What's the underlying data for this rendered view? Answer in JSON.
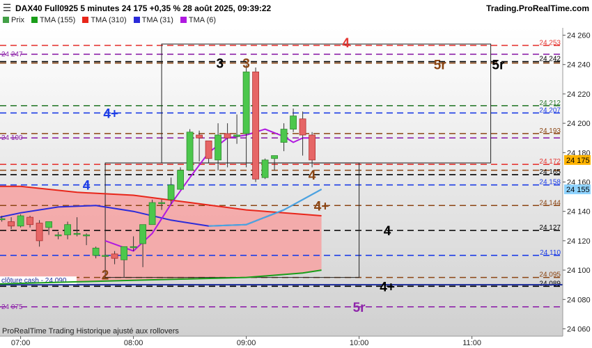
{
  "header": {
    "title": "DAX40 Full0925 5 minutes 24 175 +0,35 % 28 août 2025, 09:39:22",
    "brand": "Trading.ProRealTime.com",
    "menu_icon": "hamburger-menu-icon"
  },
  "legend": [
    {
      "label": "Prix",
      "color": "#43a047"
    },
    {
      "label": "TMA (155)",
      "color": "#1a9e1a"
    },
    {
      "label": "TMA (310)",
      "color": "#e8261a"
    },
    {
      "label": "TMA (31)",
      "color": "#2b2bd9"
    },
    {
      "label": "TMA (6)",
      "color": "#b019e0"
    }
  ],
  "footer": {
    "note": "ProRealTime Trading  Historique ajusté aux rollovers",
    "close_label": "clôture cash -  24 090"
  },
  "chart_data": {
    "type": "candlestick",
    "timeframe": "5 minutes",
    "ylim": [
      24055,
      24265
    ],
    "y_ticks": [
      "24 260",
      "24 240",
      "24 220",
      "24 200",
      "24 180",
      "24 160",
      "24 140",
      "24 120",
      "24 100",
      "24 080",
      "24 060"
    ],
    "x_ticks": [
      "07:00",
      "08:00",
      "09:00",
      "10:00",
      "11:00"
    ],
    "last_price_label": "24 175",
    "last_price": 24175,
    "tma6_label": "24 155",
    "tma6_value": 24155,
    "levels": [
      {
        "value": 24253,
        "label": "24 253",
        "color": "#e53935",
        "left_label": ""
      },
      {
        "value": 24247,
        "label": "",
        "color": "#8e24aa",
        "left_label": "24 247"
      },
      {
        "value": 24242,
        "label": "24 242",
        "color": "#000000",
        "left_label": ""
      },
      {
        "value": 24241,
        "label": "",
        "color": "#8b4513",
        "left_label": ""
      },
      {
        "value": 24212,
        "label": "24 212",
        "color": "#2e7d32",
        "left_label": ""
      },
      {
        "value": 24207,
        "label": "24 207",
        "color": "#1e3ee6",
        "left_label": ""
      },
      {
        "value": 24193,
        "label": "24 193",
        "color": "#8b4513",
        "left_label": ""
      },
      {
        "value": 24190,
        "label": "",
        "color": "#8e24aa",
        "left_label": "24 190"
      },
      {
        "value": 24172,
        "label": "24 172",
        "color": "#e53935",
        "left_label": ""
      },
      {
        "value": 24168,
        "label": "",
        "color": "#8b4513",
        "left_label": ""
      },
      {
        "value": 24165,
        "label": "24 165",
        "color": "#000000",
        "left_label": ""
      },
      {
        "value": 24158,
        "label": "24 158",
        "color": "#1e3ee6",
        "left_label": ""
      },
      {
        "value": 24144,
        "label": "24 144",
        "color": "#8b4513",
        "left_label": ""
      },
      {
        "value": 24127,
        "label": "24 127",
        "color": "#000000",
        "left_label": ""
      },
      {
        "value": 24110,
        "label": "24 110",
        "color": "#1e3ee6",
        "left_label": ""
      },
      {
        "value": 24095,
        "label": "24 095",
        "color": "#8b4513",
        "left_label": ""
      },
      {
        "value": 24089,
        "label": "24 089",
        "color": "#000000",
        "left_label": ""
      },
      {
        "value": 24075,
        "label": "",
        "color": "#8e24aa",
        "left_label": "24 075"
      }
    ],
    "close_line": 24090,
    "annotations": [
      {
        "text": "4",
        "t": "09:53",
        "y": 24255,
        "color": "#e53935"
      },
      {
        "text": "3",
        "t": "08:46",
        "y": 24241,
        "color": "#000000"
      },
      {
        "text": "3",
        "t": "09:00",
        "y": 24241,
        "color": "#8b4513"
      },
      {
        "text": "5r",
        "t": "10:43",
        "y": 24240,
        "color": "#8b4513"
      },
      {
        "text": "5r",
        "t": "11:14",
        "y": 24240,
        "color": "#000000"
      },
      {
        "text": "4+",
        "t": "07:48",
        "y": 24207,
        "color": "#1e3ee6"
      },
      {
        "text": "4",
        "t": "09:35",
        "y": 24165,
        "color": "#8b4513"
      },
      {
        "text": "4",
        "t": "07:35",
        "y": 24158,
        "color": "#1e3ee6"
      },
      {
        "text": "4+",
        "t": "09:40",
        "y": 24144,
        "color": "#8b4513"
      },
      {
        "text": "4",
        "t": "10:15",
        "y": 24127,
        "color": "#000000"
      },
      {
        "text": "2",
        "t": "07:45",
        "y": 24097,
        "color": "#8b4513"
      },
      {
        "text": "4+",
        "t": "10:15",
        "y": 24089,
        "color": "#000000"
      },
      {
        "text": "5r",
        "t": "10:00",
        "y": 24075,
        "color": "#8e24aa"
      }
    ],
    "boxes": [
      {
        "t1": "08:15",
        "t2": "11:10",
        "y1": 24173,
        "y2": 24254
      },
      {
        "t1": "07:45",
        "t2": "10:00",
        "y1": 24095,
        "y2": 24173
      }
    ],
    "candles": [
      {
        "t": "06:50",
        "o": 24135,
        "h": 24137,
        "l": 24133,
        "c": 24135
      },
      {
        "t": "06:55",
        "o": 24133,
        "h": 24136,
        "l": 24128,
        "c": 24130
      },
      {
        "t": "07:00",
        "o": 24130,
        "h": 24138,
        "l": 24129,
        "c": 24137
      },
      {
        "t": "07:05",
        "o": 24136,
        "h": 24137,
        "l": 24129,
        "c": 24131
      },
      {
        "t": "07:10",
        "o": 24132,
        "h": 24134,
        "l": 24116,
        "c": 24120
      },
      {
        "t": "07:15",
        "o": 24129,
        "h": 24133,
        "l": 24124,
        "c": 24133
      },
      {
        "t": "07:20",
        "o": 24124,
        "h": 24126,
        "l": 24121,
        "c": 24124
      },
      {
        "t": "07:25",
        "o": 24124,
        "h": 24133,
        "l": 24121,
        "c": 24131
      },
      {
        "t": "07:30",
        "o": 24125,
        "h": 24136,
        "l": 24123,
        "c": 24125
      },
      {
        "t": "07:35",
        "o": 24124,
        "h": 24125,
        "l": 24117,
        "c": 24124
      },
      {
        "t": "07:40",
        "o": 24110,
        "h": 24116,
        "l": 24108,
        "c": 24115
      },
      {
        "t": "07:45",
        "o": 24110,
        "h": 24114,
        "l": 24107,
        "c": 24110
      },
      {
        "t": "07:50",
        "o": 24111,
        "h": 24113,
        "l": 24104,
        "c": 24108
      },
      {
        "t": "07:55",
        "o": 24107,
        "h": 24113,
        "l": 24095,
        "c": 24116
      },
      {
        "t": "08:00",
        "o": 24116,
        "h": 24123,
        "l": 24113,
        "c": 24116
      },
      {
        "t": "08:05",
        "o": 24118,
        "h": 24131,
        "l": 24102,
        "c": 24131
      },
      {
        "t": "08:10",
        "o": 24131,
        "h": 24148,
        "l": 24131,
        "c": 24146
      },
      {
        "t": "08:15",
        "o": 24146,
        "h": 24148,
        "l": 24141,
        "c": 24146
      },
      {
        "t": "08:20",
        "o": 24148,
        "h": 24163,
        "l": 24145,
        "c": 24158
      },
      {
        "t": "08:25",
        "o": 24155,
        "h": 24170,
        "l": 24155,
        "c": 24168
      },
      {
        "t": "08:30",
        "o": 24168,
        "h": 24196,
        "l": 24168,
        "c": 24194
      },
      {
        "t": "08:35",
        "o": 24192,
        "h": 24195,
        "l": 24174,
        "c": 24190
      },
      {
        "t": "08:40",
        "o": 24188,
        "h": 24186,
        "l": 24173,
        "c": 24176
      },
      {
        "t": "08:45",
        "o": 24175,
        "h": 24200,
        "l": 24168,
        "c": 24192
      },
      {
        "t": "08:50",
        "o": 24193,
        "h": 24200,
        "l": 24170,
        "c": 24190
      },
      {
        "t": "08:55",
        "o": 24191,
        "h": 24206,
        "l": 24186,
        "c": 24192
      },
      {
        "t": "09:00",
        "o": 24193,
        "h": 24240,
        "l": 24170,
        "c": 24235
      },
      {
        "t": "09:05",
        "o": 24235,
        "h": 24238,
        "l": 24160,
        "c": 24162
      },
      {
        "t": "09:10",
        "o": 24163,
        "h": 24176,
        "l": 24162,
        "c": 24175
      },
      {
        "t": "09:15",
        "o": 24176,
        "h": 24178,
        "l": 24168,
        "c": 24178
      },
      {
        "t": "09:20",
        "o": 24187,
        "h": 24200,
        "l": 24181,
        "c": 24196
      },
      {
        "t": "09:25",
        "o": 24196,
        "h": 24210,
        "l": 24194,
        "c": 24205
      },
      {
        "t": "09:30",
        "o": 24203,
        "h": 24208,
        "l": 24178,
        "c": 24192
      },
      {
        "t": "09:35",
        "o": 24192,
        "h": 24194,
        "l": 24170,
        "c": 24175
      }
    ],
    "tma": [
      {
        "name": "TMA (155)",
        "color": "#1a9e1a",
        "points": [
          [
            "06:30",
            24090
          ],
          [
            "07:30",
            24092
          ],
          [
            "08:00",
            24093
          ],
          [
            "08:30",
            24094
          ],
          [
            "09:00",
            24095
          ],
          [
            "09:30",
            24098
          ],
          [
            "09:40",
            24100
          ]
        ]
      },
      {
        "name": "TMA (310)",
        "color": "#e8261a",
        "points": [
          [
            "06:30",
            24157
          ],
          [
            "07:00",
            24157
          ],
          [
            "07:30",
            24153
          ],
          [
            "08:00",
            24151
          ],
          [
            "08:30",
            24146
          ],
          [
            "09:00",
            24141
          ],
          [
            "09:30",
            24138
          ],
          [
            "09:40",
            24137
          ]
        ]
      },
      {
        "name": "TMA (31)",
        "color": "#2b2bd9",
        "points": [
          [
            "06:30",
            24131
          ],
          [
            "07:00",
            24139
          ],
          [
            "07:20",
            24143
          ],
          [
            "07:40",
            24144
          ],
          [
            "08:00",
            24140
          ],
          [
            "08:20",
            24134
          ],
          [
            "08:40",
            24130
          ],
          [
            "09:00",
            24131
          ],
          [
            "09:20",
            24141
          ],
          [
            "09:40",
            24155
          ]
        ]
      },
      {
        "name": "TMA (6)",
        "color": "#b019e0",
        "points": [
          [
            "07:45",
            24120
          ],
          [
            "08:00",
            24113
          ],
          [
            "08:10",
            24125
          ],
          [
            "08:20",
            24145
          ],
          [
            "08:30",
            24163
          ],
          [
            "08:40",
            24180
          ],
          [
            "08:50",
            24190
          ],
          [
            "09:00",
            24192
          ],
          [
            "09:10",
            24196
          ],
          [
            "09:20",
            24191
          ],
          [
            "09:25",
            24187
          ],
          [
            "09:30",
            24190
          ],
          [
            "09:35",
            24190
          ]
        ]
      }
    ]
  }
}
